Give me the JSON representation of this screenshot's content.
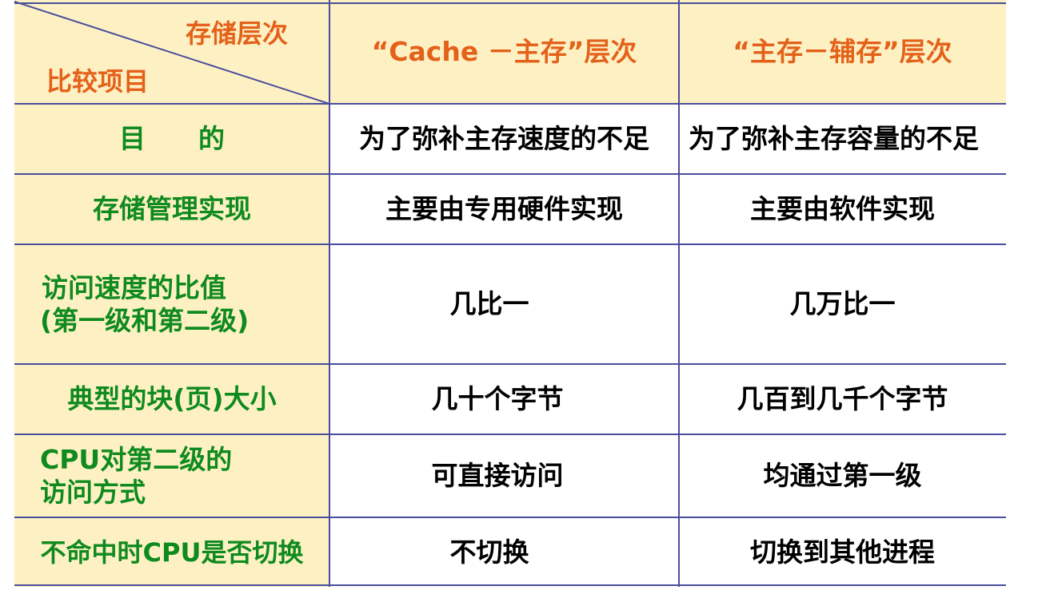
{
  "colors": {
    "header_bg": "#fdf1c4",
    "left_column_bg": "#fdf1c4",
    "rule_color": "#4a4d9c",
    "left_text": "#0f8a1e",
    "header_text": "#e4611a",
    "body_text": "#000000"
  },
  "header": {
    "diagonal_top": "存储层次",
    "diagonal_bottom": "比较项目",
    "col1": "“Cache －主存”层次",
    "col2": "“主存－辅存”层次"
  },
  "rows": [
    {
      "item": "目　　的",
      "cache": "为了弥补主存速度的不足",
      "vm": "为了弥补主存容量的不足"
    },
    {
      "item": "存储管理实现",
      "cache": "主要由专用硬件实现",
      "vm": "主要由软件实现"
    },
    {
      "item_line1": "访问速度的比值",
      "item_line2": "(第一级和第二级)",
      "cache": "几比一",
      "vm": "几万比一"
    },
    {
      "item": "典型的块(页)大小",
      "cache": "几十个字节",
      "vm": "几百到几千个字节"
    },
    {
      "item_line1": "CPU对第二级的",
      "item_line2": "访问方式",
      "cache": "可直接访问",
      "vm": "均通过第一级"
    },
    {
      "item": "不命中时CPU是否切换",
      "cache": "不切换",
      "vm": "切换到其他进程"
    }
  ]
}
